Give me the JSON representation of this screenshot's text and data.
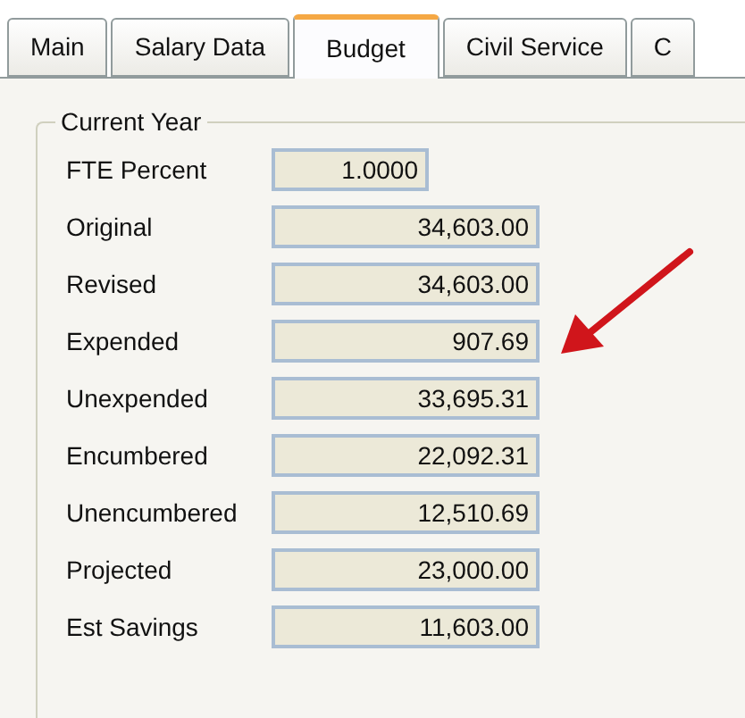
{
  "tabs": [
    {
      "label": "Main",
      "selected": false
    },
    {
      "label": "Salary Data",
      "selected": false
    },
    {
      "label": "Budget",
      "selected": true
    },
    {
      "label": "Civil Service",
      "selected": false
    },
    {
      "label": "C",
      "selected": false
    }
  ],
  "group": {
    "title": "Current Year",
    "fields": [
      {
        "label": "FTE Percent",
        "value": "1.0000",
        "kind": "short"
      },
      {
        "label": "Original",
        "value": "34,603.00",
        "kind": "wide"
      },
      {
        "label": "Revised",
        "value": "34,603.00",
        "kind": "wide"
      },
      {
        "label": "Expended",
        "value": "907.69",
        "kind": "wide"
      },
      {
        "label": "Unexpended",
        "value": "33,695.31",
        "kind": "wide"
      },
      {
        "label": "Encumbered",
        "value": "22,092.31",
        "kind": "wide"
      },
      {
        "label": "Unencumbered",
        "value": "12,510.69",
        "kind": "wide"
      },
      {
        "label": "Projected",
        "value": "23,000.00",
        "kind": "wide"
      },
      {
        "label": "Est Savings",
        "value": "11,603.00",
        "kind": "wide"
      }
    ]
  }
}
